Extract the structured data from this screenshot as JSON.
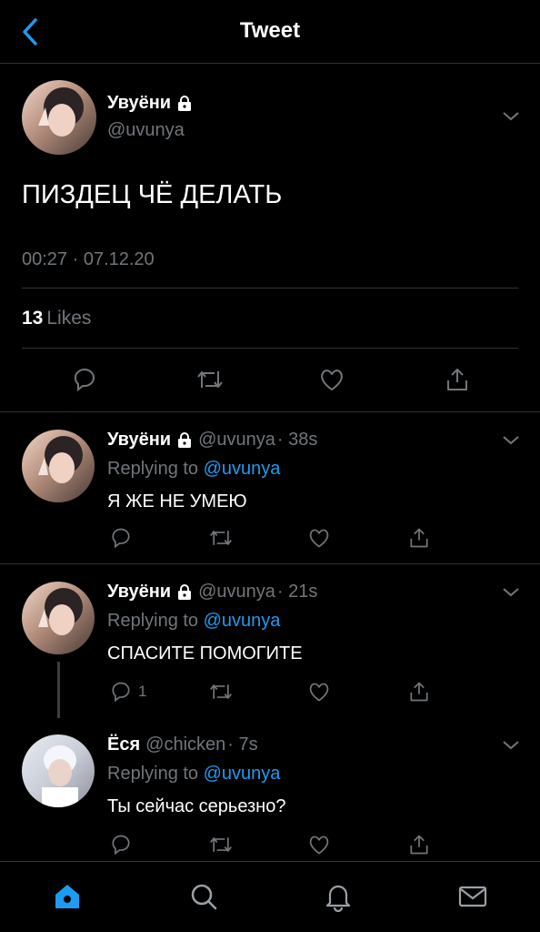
{
  "header": {
    "title": "Tweet",
    "back_icon": "chevron-left-icon"
  },
  "colors": {
    "accent": "#1d9bf0",
    "muted": "#71767b",
    "divider": "#2f3336",
    "background": "#000000"
  },
  "main_tweet": {
    "name": "Увуёни",
    "handle": "@uvunya",
    "text": "ПИЗДЕЦ ЧЁ ДЕЛАТЬ",
    "timestamp": "00:27 · 07.12.20",
    "likes_count": "13",
    "likes_label": "Likes"
  },
  "replies": [
    {
      "name": "Увуёни",
      "handle": "@uvunya",
      "time": "· 38s",
      "replying_prefix": "Replying to",
      "replying_to": "@uvunya",
      "text": "Я ЖЕ НЕ УМЕЮ",
      "reply_count": ""
    },
    {
      "name": "Увуёни",
      "handle": "@uvunya",
      "time": "· 21s",
      "replying_prefix": "Replying to",
      "replying_to": "@uvunya",
      "text": "СПАСИТЕ ПОМОГИТЕ",
      "reply_count": "1"
    },
    {
      "name": "Ёся",
      "handle": "@chicken",
      "time": "· 7s",
      "replying_prefix": "Replying to",
      "replying_to": "@uvunya",
      "text": "Ты сейчас серьезно?",
      "reply_count": ""
    }
  ],
  "tabbar": [
    "home-icon",
    "search-icon",
    "notifications-bell-icon",
    "messages-envelope-icon"
  ]
}
